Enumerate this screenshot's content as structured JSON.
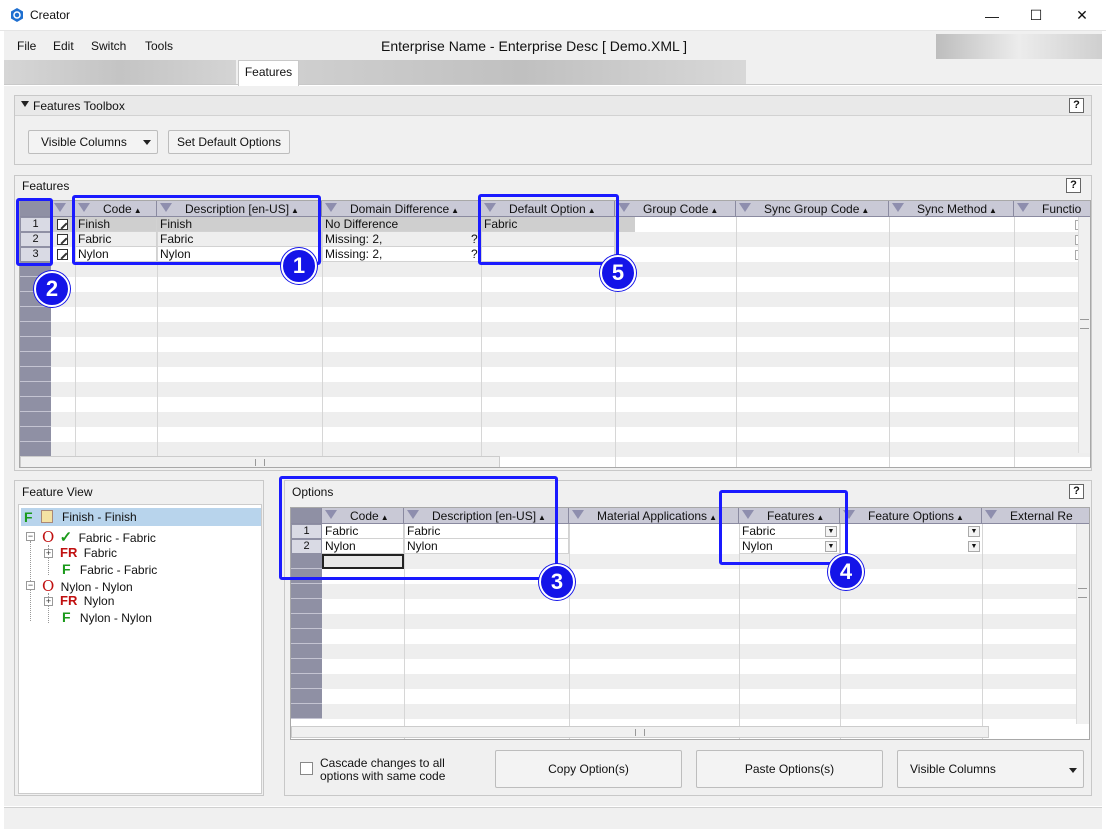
{
  "window": {
    "title": "Creator",
    "minimize_glyph": "—",
    "maximize_glyph": "☐",
    "close_glyph": "✕"
  },
  "menu": [
    "File",
    "Edit",
    "Switch",
    "Tools"
  ],
  "document_title": "Enterprise Name - Enterprise Desc [ Demo.XML ]",
  "tabs": {
    "active": "Features"
  },
  "toolbox": {
    "title": "Features Toolbox",
    "help": "?",
    "visible_columns": "Visible Columns",
    "set_default": "Set Default Options"
  },
  "features_panel": {
    "title": "Features",
    "help": "?",
    "columns": [
      "Code",
      "Description [en-US]",
      "Domain Difference",
      "Default Option",
      "Group Code",
      "Sync Group Code",
      "Sync Method",
      "Functio"
    ],
    "rows": [
      {
        "num": "1",
        "code": "Finish",
        "desc": "Finish",
        "domain": "No Difference",
        "domain_q": "",
        "default": "Fabric"
      },
      {
        "num": "2",
        "code": "Fabric",
        "desc": "Fabric",
        "domain": "Missing: 2,",
        "domain_q": "?",
        "default": ""
      },
      {
        "num": "3",
        "code": "Nylon",
        "desc": "Nylon",
        "domain": "Missing: 2,",
        "domain_q": "?",
        "default": ""
      }
    ]
  },
  "feature_view": {
    "title": "Feature View",
    "nodes": [
      {
        "glyph": "F",
        "text": "Finish - Finish"
      },
      {
        "glyph": "O",
        "text": "Fabric - Fabric"
      },
      {
        "glyph": "FR",
        "text": "Fabric"
      },
      {
        "glyph": "F",
        "text": "Fabric - Fabric"
      },
      {
        "glyph": "O",
        "text": "Nylon - Nylon"
      },
      {
        "glyph": "FR",
        "text": "Nylon"
      },
      {
        "glyph": "F",
        "text": "Nylon - Nylon"
      }
    ],
    "expander_minus": "−",
    "expander_plus": "+"
  },
  "options_panel": {
    "title": "Options",
    "help": "?",
    "columns": [
      "Code",
      "Description [en-US]",
      "Material Applications",
      "Features",
      "Feature Options",
      "External Re"
    ],
    "rows": [
      {
        "num": "1",
        "code": "Fabric",
        "desc": "Fabric",
        "features": "Fabric"
      },
      {
        "num": "2",
        "code": "Nylon",
        "desc": "Nylon",
        "features": "Nylon"
      }
    ],
    "cascade_label": "Cascade changes to all options with same code",
    "copy_button": "Copy Option(s)",
    "paste_button": "Paste Options(s)",
    "visible_columns": "Visible Columns"
  },
  "badges": [
    "1",
    "2",
    "3",
    "4",
    "5"
  ],
  "accent_color": "#1a1aff"
}
